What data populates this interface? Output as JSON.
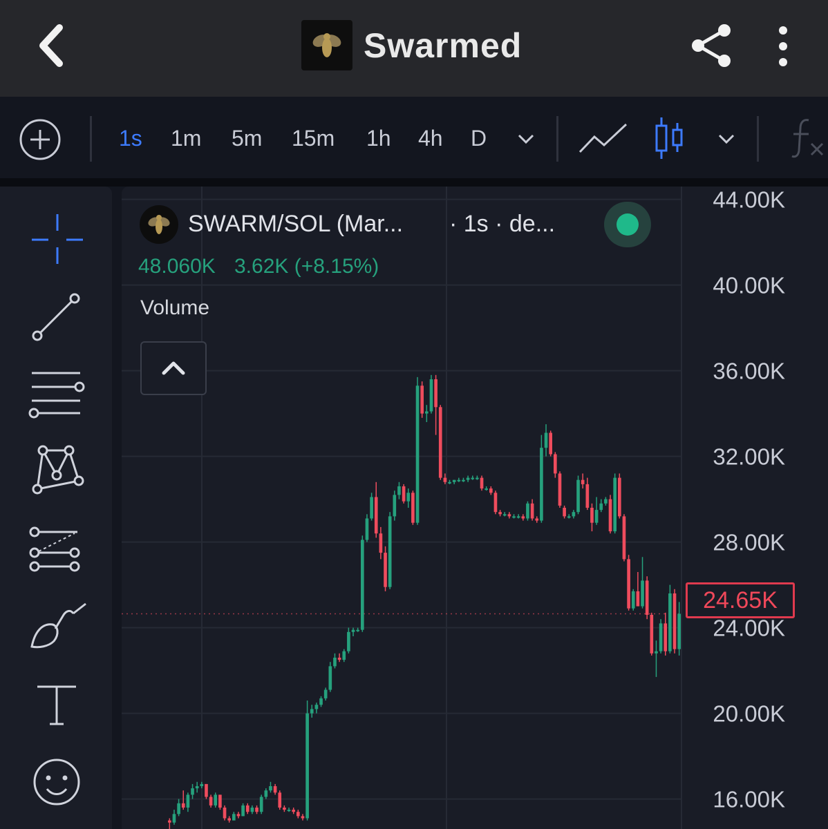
{
  "app": {
    "title": "Swarmed"
  },
  "toolbar": {
    "intervals": [
      "1s",
      "1m",
      "5m",
      "15m",
      "1h",
      "4h",
      "D"
    ],
    "active_interval": "1s",
    "chart_type": "candles"
  },
  "legend": {
    "pair": "SWARM/SOL (Mar...",
    "interval": "· 1s · de...",
    "price": "48.060K",
    "change": "3.62K (+8.15%)",
    "volume_label": "Volume"
  },
  "price_badge": {
    "value": "24.65K"
  },
  "colors": {
    "up": "#26a17d",
    "down": "#ef4c5d",
    "accent": "#3d7bff",
    "live": "#1fb98a"
  },
  "chart_data": {
    "type": "candlestick",
    "y_ticks": [
      "44.00K",
      "40.00K",
      "36.00K",
      "32.00K",
      "28.00K",
      "24.00K",
      "20.00K",
      "16.00K"
    ],
    "ylim": [
      14600,
      44600
    ],
    "current_price": 24650,
    "candles": [
      [
        15000,
        15100,
        14600,
        14900
      ],
      [
        14900,
        15500,
        14800,
        15300
      ],
      [
        15300,
        16000,
        15200,
        15800
      ],
      [
        15800,
        16400,
        15500,
        15600
      ],
      [
        15600,
        16300,
        15400,
        16200
      ],
      [
        16200,
        16700,
        16000,
        16500
      ],
      [
        16500,
        16800,
        16300,
        16600
      ],
      [
        16600,
        16800,
        16500,
        16700
      ],
      [
        16700,
        16700,
        16000,
        16100
      ],
      [
        16100,
        16200,
        15600,
        15700
      ],
      [
        15700,
        16300,
        15600,
        16200
      ],
      [
        16200,
        16200,
        15500,
        15600
      ],
      [
        15600,
        15700,
        15000,
        15100
      ],
      [
        15100,
        15200,
        14900,
        15000
      ],
      [
        15000,
        15400,
        15000,
        15300
      ],
      [
        15300,
        15400,
        15100,
        15200
      ],
      [
        15200,
        15800,
        15200,
        15700
      ],
      [
        15700,
        15800,
        15300,
        15400
      ],
      [
        15400,
        15700,
        15300,
        15600
      ],
      [
        15600,
        15700,
        15300,
        15400
      ],
      [
        15400,
        16200,
        15300,
        16100
      ],
      [
        16100,
        16500,
        16000,
        16400
      ],
      [
        16400,
        16800,
        16300,
        16600
      ],
      [
        16600,
        16700,
        16200,
        16300
      ],
      [
        16300,
        16400,
        15500,
        15600
      ],
      [
        15600,
        15700,
        15400,
        15500
      ],
      [
        15500,
        15600,
        15400,
        15500
      ],
      [
        15500,
        15600,
        15300,
        15400
      ],
      [
        15400,
        15500,
        15100,
        15200
      ],
      [
        15200,
        15300,
        15000,
        15100
      ],
      [
        15100,
        20600,
        15000,
        20000
      ],
      [
        20000,
        20400,
        19800,
        20200
      ],
      [
        20200,
        20500,
        20000,
        20400
      ],
      [
        20400,
        20800,
        20300,
        20700
      ],
      [
        20700,
        21200,
        20600,
        21100
      ],
      [
        21100,
        22400,
        21000,
        22200
      ],
      [
        22200,
        22800,
        22100,
        22600
      ],
      [
        22600,
        22800,
        22400,
        22500
      ],
      [
        22500,
        23000,
        22400,
        22900
      ],
      [
        22900,
        24000,
        22800,
        23800
      ],
      [
        23800,
        24000,
        23600,
        23900
      ],
      [
        23900,
        24000,
        23800,
        23900
      ],
      [
        23900,
        28300,
        23800,
        28100
      ],
      [
        28100,
        29300,
        28000,
        29100
      ],
      [
        29100,
        30300,
        29000,
        30100
      ],
      [
        30100,
        30800,
        28200,
        28400
      ],
      [
        28400,
        28700,
        27200,
        27500
      ],
      [
        27500,
        27800,
        25700,
        25900
      ],
      [
        25900,
        29400,
        25800,
        29200
      ],
      [
        29200,
        30400,
        29000,
        30200
      ],
      [
        30200,
        30800,
        30000,
        30600
      ],
      [
        30600,
        30700,
        29800,
        29900
      ],
      [
        29900,
        30500,
        29600,
        30300
      ],
      [
        30300,
        30400,
        28800,
        28900
      ],
      [
        28900,
        35700,
        28800,
        35300
      ],
      [
        35300,
        35500,
        33800,
        34000
      ],
      [
        34000,
        34400,
        33600,
        34100
      ],
      [
        34100,
        35800,
        34000,
        35600
      ],
      [
        35600,
        35800,
        33000,
        34300
      ],
      [
        34300,
        34400,
        30900,
        31000
      ],
      [
        31000,
        31200,
        30700,
        30800
      ],
      [
        30800,
        30900,
        30700,
        30800
      ],
      [
        30800,
        30900,
        30700,
        30900
      ],
      [
        30900,
        31000,
        30800,
        30900
      ],
      [
        30900,
        31000,
        30800,
        30900
      ],
      [
        30900,
        31100,
        30800,
        31000
      ],
      [
        31000,
        31100,
        30900,
        31000
      ],
      [
        31000,
        31100,
        30900,
        31000
      ],
      [
        31000,
        31100,
        30400,
        30500
      ],
      [
        30500,
        30600,
        30400,
        30500
      ],
      [
        30500,
        30600,
        30200,
        30300
      ],
      [
        30300,
        30400,
        29300,
        29400
      ],
      [
        29400,
        29500,
        29200,
        29300
      ],
      [
        29300,
        29400,
        29200,
        29300
      ],
      [
        29300,
        29400,
        29100,
        29200
      ],
      [
        29200,
        29300,
        29100,
        29200
      ],
      [
        29200,
        29300,
        29100,
        29200
      ],
      [
        29200,
        29300,
        29000,
        29100
      ],
      [
        29100,
        29900,
        29000,
        29800
      ],
      [
        29800,
        30000,
        29000,
        29100
      ],
      [
        29100,
        29200,
        28900,
        29000
      ],
      [
        29000,
        33000,
        28900,
        32400
      ],
      [
        32400,
        33500,
        32000,
        33100
      ],
      [
        33100,
        33200,
        32000,
        32100
      ],
      [
        32100,
        32200,
        31000,
        31200
      ],
      [
        31200,
        31300,
        29600,
        29700
      ],
      [
        29600,
        29700,
        29100,
        29200
      ],
      [
        29200,
        29300,
        29100,
        29200
      ],
      [
        29200,
        29500,
        29100,
        29400
      ],
      [
        29400,
        31100,
        29300,
        30900
      ],
      [
        30900,
        31200,
        30500,
        30700
      ],
      [
        30700,
        31000,
        29500,
        29600
      ],
      [
        29600,
        29800,
        28500,
        28900
      ],
      [
        28900,
        30100,
        28800,
        29500
      ],
      [
        29500,
        30000,
        29400,
        29800
      ],
      [
        29800,
        30100,
        29700,
        30000
      ],
      [
        30000,
        30200,
        28400,
        28500
      ],
      [
        28500,
        31200,
        28400,
        31000
      ],
      [
        31000,
        31200,
        29100,
        29200
      ],
      [
        29200,
        29300,
        27100,
        27200
      ],
      [
        27200,
        27400,
        24800,
        24900
      ],
      [
        24900,
        25800,
        24800,
        25700
      ],
      [
        25700,
        26600,
        25500,
        25000
      ],
      [
        25000,
        27300,
        24900,
        26200
      ],
      [
        26200,
        26400,
        24400,
        24600
      ],
      [
        24600,
        24700,
        22700,
        22800
      ],
      [
        22800,
        23400,
        21700,
        22900
      ],
      [
        22900,
        24400,
        22800,
        24200
      ],
      [
        24200,
        24700,
        22700,
        22900
      ],
      [
        22900,
        26000,
        22800,
        25600
      ],
      [
        25600,
        25800,
        22800,
        23000
      ],
      [
        23000,
        25200,
        22700,
        24650
      ]
    ]
  }
}
